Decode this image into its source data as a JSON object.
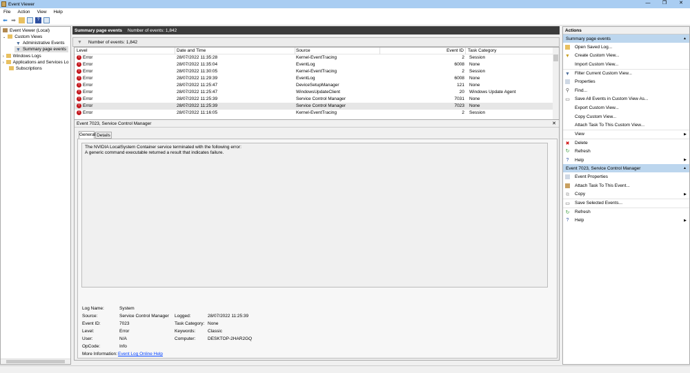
{
  "window": {
    "title": "Event Viewer",
    "min": "—",
    "max": "❐",
    "close": "✕"
  },
  "menu": [
    "File",
    "Action",
    "View",
    "Help"
  ],
  "tree": {
    "root": "Event Viewer (Local)",
    "custom_views": "Custom Views",
    "admin_events": "Administrative Events",
    "summary": "Summary page events",
    "windows_logs": "Windows Logs",
    "apps_services": "Applications and Services Lo",
    "subscriptions": "Subscriptions"
  },
  "center": {
    "header_title": "Summary page events",
    "header_count": "Number of events: 1,842",
    "filter_text": "Number of events: 1,842",
    "columns": [
      "Level",
      "Date and Time",
      "Source",
      "Event ID",
      "Task Category"
    ],
    "rows": [
      {
        "level": "Error",
        "date": "28/07/2022 11:35:28",
        "source": "Kernel-EventTracing",
        "id": "2",
        "cat": "Session"
      },
      {
        "level": "Error",
        "date": "28/07/2022 11:35:04",
        "source": "EventLog",
        "id": "6008",
        "cat": "None"
      },
      {
        "level": "Error",
        "date": "28/07/2022 11:30:05",
        "source": "Kernel-EventTracing",
        "id": "2",
        "cat": "Session"
      },
      {
        "level": "Error",
        "date": "28/07/2022 11:29:39",
        "source": "EventLog",
        "id": "6008",
        "cat": "None"
      },
      {
        "level": "Error",
        "date": "28/07/2022 11:25:47",
        "source": "DeviceSetupManager",
        "id": "121",
        "cat": "None"
      },
      {
        "level": "Error",
        "date": "28/07/2022 11:25:47",
        "source": "WindowsUpdateClient",
        "id": "20",
        "cat": "Windows Update Agent"
      },
      {
        "level": "Error",
        "date": "28/07/2022 11:25:39",
        "source": "Service Control Manager",
        "id": "7031",
        "cat": "None"
      },
      {
        "level": "Error",
        "date": "28/07/2022 11:25:39",
        "source": "Service Control Manager",
        "id": "7023",
        "cat": "None"
      },
      {
        "level": "Error",
        "date": "28/07/2022 11:16:05",
        "source": "Kernel-EventTracing",
        "id": "2",
        "cat": "Session"
      }
    ]
  },
  "detail": {
    "title": "Event 7023, Service Control Manager",
    "tabs": [
      "General",
      "Details"
    ],
    "message1": "The NVIDIA LocalSystem Container service terminated with the following error:",
    "message2": "A generic command executable returned a result that indicates failure.",
    "fields": {
      "log_name_l": "Log Name:",
      "log_name": "System",
      "source_l": "Source:",
      "source": "Service Control Manager",
      "logged_l": "Logged:",
      "logged": "28/07/2022 11:25:39",
      "event_id_l": "Event ID:",
      "event_id": "7023",
      "task_l": "Task Category:",
      "task": "None",
      "level_l": "Level:",
      "level": "Error",
      "keywords_l": "Keywords:",
      "keywords": "Classic",
      "user_l": "User:",
      "user": "N/A",
      "computer_l": "Computer:",
      "computer": "DESKTOP-2HAR2GQ",
      "opcode_l": "OpCode:",
      "opcode": "Info",
      "more_l": "More Information:",
      "more": "Event Log Online Help"
    }
  },
  "actions": {
    "title": "Actions",
    "section1": "Summary page events",
    "items1": [
      "Open Saved Log...",
      "Create Custom View...",
      "Import Custom View...",
      "Filter Current Custom View...",
      "Properties",
      "Find...",
      "Save All Events in Custom View As...",
      "Export Custom View...",
      "Copy Custom View...",
      "Attach Task To This Custom View...",
      "View",
      "Delete",
      "Refresh",
      "Help"
    ],
    "section2": "Event 7023, Service Control Manager",
    "items2": [
      "Event Properties",
      "Attach Task To This Event...",
      "Copy",
      "Save Selected Events...",
      "Refresh",
      "Help"
    ]
  }
}
